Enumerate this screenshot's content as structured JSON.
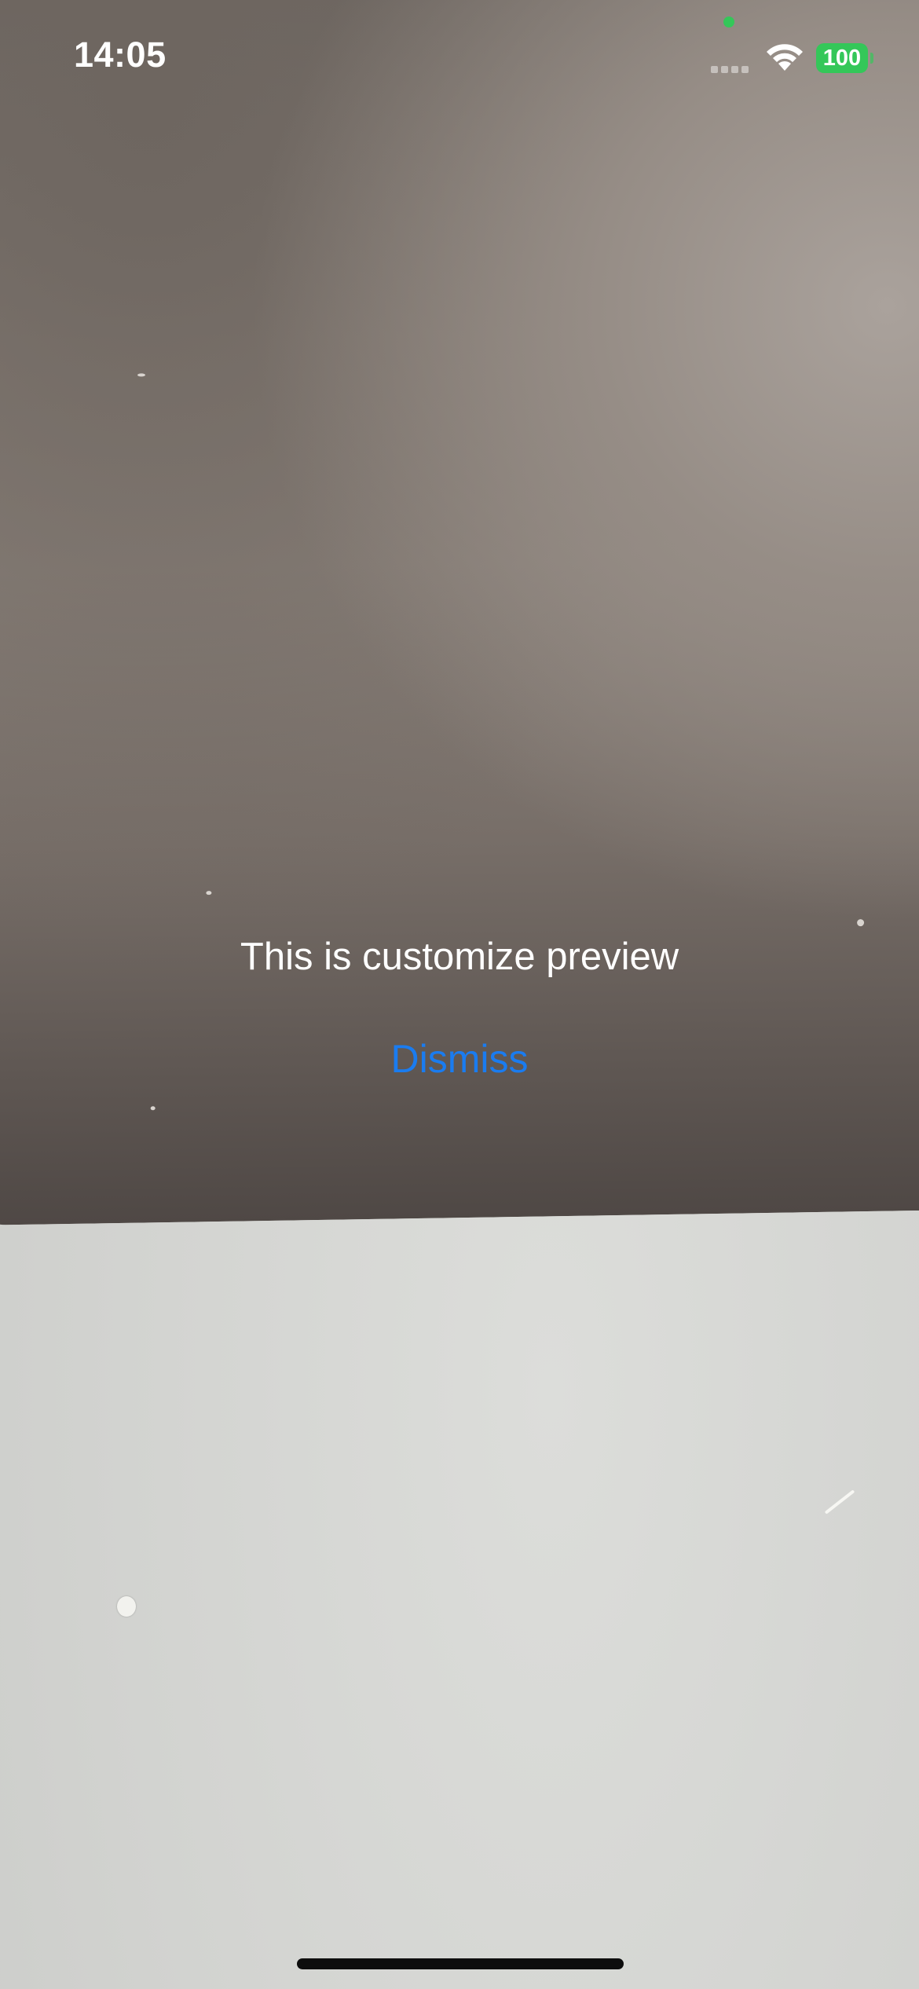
{
  "status_bar": {
    "time": "14:05",
    "battery_level": "100",
    "privacy_indicator_color": "#34c759",
    "battery_color": "#34c759",
    "icons": [
      "cellular-signal-icon",
      "wifi-icon",
      "battery-icon"
    ]
  },
  "preview": {
    "caption": "This is customize preview",
    "dismiss_label": "Dismiss",
    "dismiss_color": "#1a7cf0"
  }
}
